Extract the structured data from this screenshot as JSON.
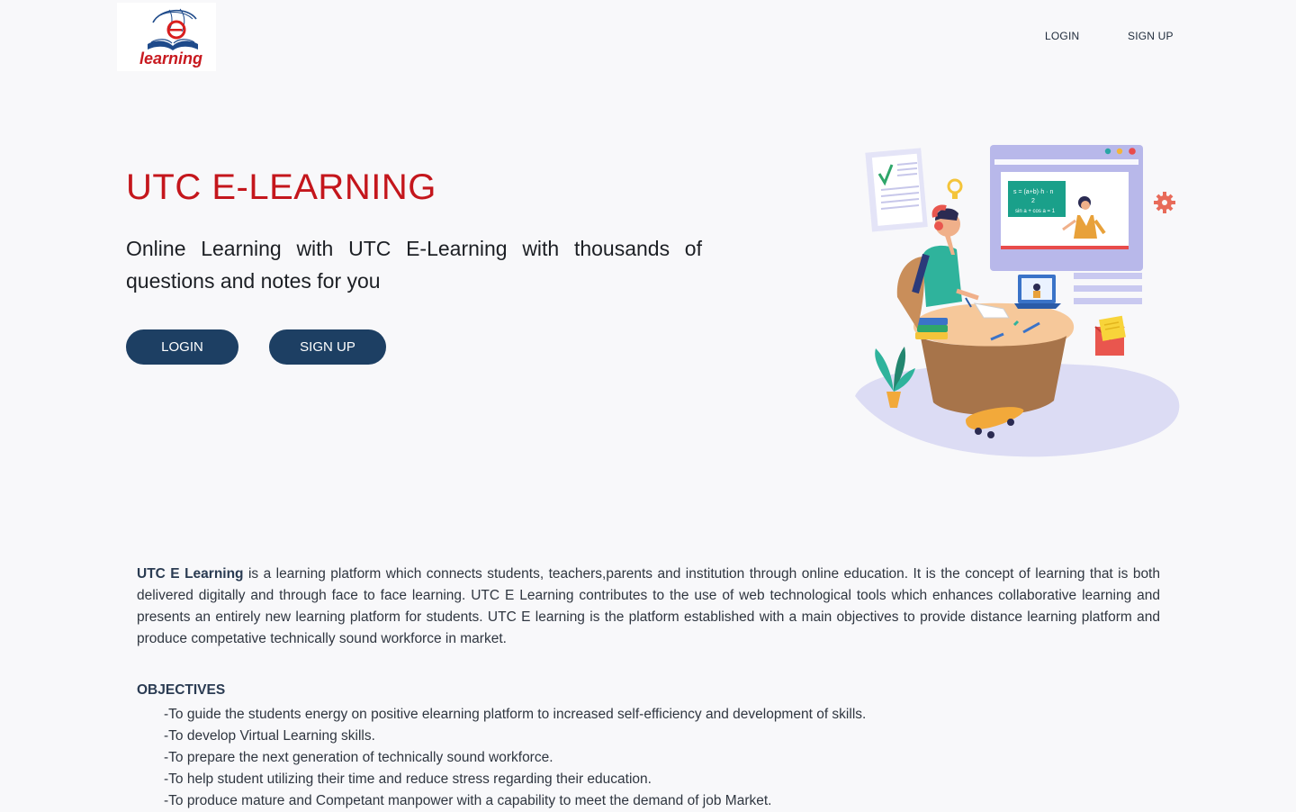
{
  "header": {
    "logo_text": "learning",
    "nav": {
      "login_label": "LOGIN",
      "signup_label": "SIGN UP"
    }
  },
  "hero": {
    "title": "UTC E-LEARNING",
    "subtitle": "Online Learning with UTC E-Learning with thousands of questions and notes for you",
    "login_button": "LOGIN",
    "signup_button": "SIGN UP",
    "illustration": {
      "board_formula_line1": "s = (a+b)·h · n",
      "board_formula_line2": "2",
      "board_formula_line3": "sin a + cos a = 1"
    }
  },
  "about": {
    "brand": "UTC E Learning",
    "text": " is a learning platform which connects students, teachers,parents and institution through online education. It is the concept of learning that is both delivered digitally and through face to face learning. UTC E Learning contributes to the use of web technological tools which enhances collaborative learning and presents an entirely new learning platform for students. UTC E learning is the platform established with a main objectives to provide distance learning platform and produce competative technically sound workforce in market."
  },
  "objectives": {
    "heading": "OBJECTIVES",
    "items": [
      "-To guide the students energy on positive elearning platform to increased self-efficiency and development of skills.",
      "-To develop Virtual Learning skills.",
      "-To prepare the next generation of technically sound workforce.",
      "-To help student utilizing their time and reduce stress regarding their education.",
      "-To produce mature and Competant manpower with a capability to meet the demand of job Market."
    ]
  },
  "colors": {
    "title_red": "#c4161c",
    "button_navy": "#1d3f63",
    "background": "#f8f8fa"
  }
}
